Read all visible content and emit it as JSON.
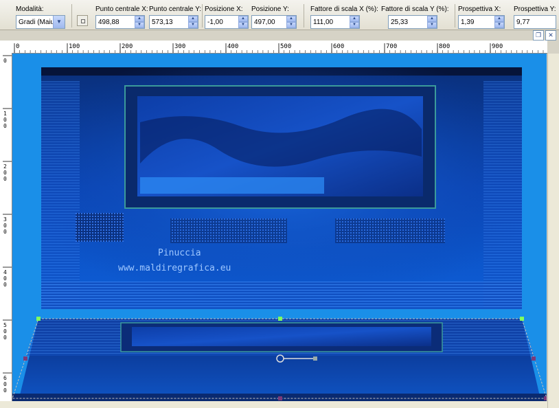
{
  "toolbar": {
    "mode": {
      "label": "Modalità:",
      "value": "Gradi (Maiu:"
    },
    "fields": [
      {
        "label": "Punto centrale X:",
        "value": "498,88"
      },
      {
        "label": "Punto centrale Y:",
        "value": "573,13"
      },
      {
        "label": "Posizione X:",
        "value": "-1,00"
      },
      {
        "label": "Posizione Y:",
        "value": "497,00"
      },
      {
        "label": "Fattore di scala X (%):",
        "value": "111,00"
      },
      {
        "label": "Fattore di scala Y (%):",
        "value": "25,33"
      },
      {
        "label": "Prospettiva X:",
        "value": "1,39"
      },
      {
        "label": "Prospettiva Y:",
        "value": "9,77"
      }
    ]
  },
  "ruler": {
    "top_ticks": [
      "0",
      "100",
      "200",
      "300",
      "400",
      "500",
      "600",
      "700",
      "800",
      "900"
    ],
    "left_ticks": [
      "0",
      "100",
      "200",
      "300",
      "400",
      "500",
      "600"
    ]
  },
  "watermark": {
    "line1": "Pinuccia",
    "line2": "www.maldiregrafica.eu"
  },
  "colors": {
    "canvas": "#1a8fe8",
    "handle_green": "#7fff5f",
    "handle_purple": "#7a3a7a"
  }
}
